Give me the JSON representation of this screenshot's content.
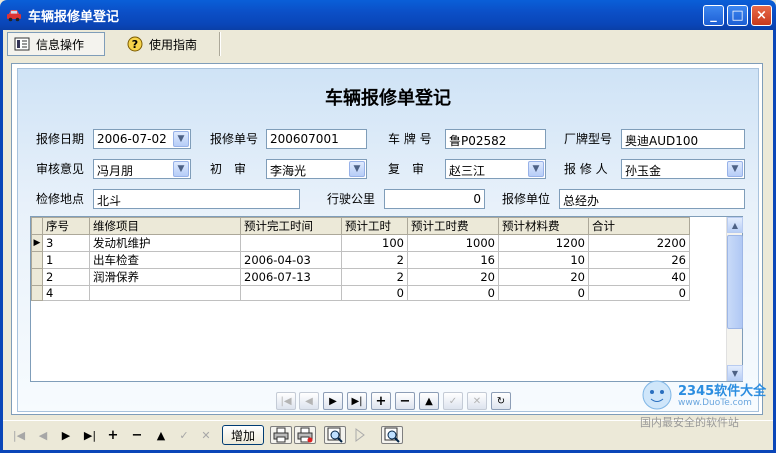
{
  "window": {
    "title": "车辆报修单登记",
    "controls": {
      "minimize": "_",
      "maximize": "□",
      "close": "×"
    }
  },
  "toolbar": {
    "items": [
      {
        "label": "信息操作",
        "icon": "form-list-icon",
        "active": true
      },
      {
        "label": "使用指南",
        "icon": "help-icon",
        "active": false
      }
    ]
  },
  "form": {
    "title": "车辆报修单登记",
    "fields": {
      "repair_date": {
        "label": "报修日期",
        "value": "2006-07-02"
      },
      "repair_no": {
        "label": "报修单号",
        "value": "200607001"
      },
      "plate_no": {
        "label": "车 牌 号",
        "value": "鲁P02582"
      },
      "model": {
        "label": "厂牌型号",
        "value": "奥迪AUD100"
      },
      "audit_opinion": {
        "label": "审核意见",
        "value": "冯月朋"
      },
      "first_review": {
        "label": "初　审",
        "value": "李海光"
      },
      "second_review": {
        "label": "复　审",
        "value": "赵三江"
      },
      "reporter": {
        "label": "报 修 人",
        "value": "孙玉金"
      },
      "location": {
        "label": "检修地点",
        "value": "北斗"
      },
      "mileage": {
        "label": "行驶公里",
        "value": "0"
      },
      "unit": {
        "label": "报修单位",
        "value": "总经办"
      }
    }
  },
  "grid": {
    "columns": [
      "序号",
      "维修项目",
      "预计完工时间",
      "预计工时",
      "预计工时费",
      "预计材料费",
      "合计"
    ],
    "rows": [
      {
        "current": true,
        "cells": [
          "3",
          "发动机维护",
          "",
          "100",
          "1000",
          "1200",
          "2200"
        ]
      },
      {
        "current": false,
        "cells": [
          "1",
          "出车检查",
          "2006-04-03",
          "2",
          "16",
          "10",
          "26"
        ]
      },
      {
        "current": false,
        "cells": [
          "2",
          "润滑保养",
          "2006-07-13",
          "2",
          "20",
          "20",
          "40"
        ]
      },
      {
        "current": false,
        "cells": [
          "4",
          "",
          "",
          "0",
          "0",
          "0",
          "0"
        ]
      }
    ]
  },
  "navigator": {
    "buttons": [
      {
        "name": "first",
        "glyph": "|◀",
        "enabled": false
      },
      {
        "name": "prior",
        "glyph": "◀",
        "enabled": false
      },
      {
        "name": "next",
        "glyph": "▶",
        "enabled": true
      },
      {
        "name": "last",
        "glyph": "▶|",
        "enabled": true
      },
      {
        "name": "insert",
        "glyph": "+",
        "enabled": true
      },
      {
        "name": "delete",
        "glyph": "−",
        "enabled": true
      },
      {
        "name": "edit",
        "glyph": "▲",
        "enabled": true
      },
      {
        "name": "post",
        "glyph": "✓",
        "enabled": false
      },
      {
        "name": "cancel",
        "glyph": "✕",
        "enabled": false
      },
      {
        "name": "refresh",
        "glyph": "↻",
        "enabled": true
      }
    ]
  },
  "bottombar": {
    "add_label": "增加",
    "nav": [
      {
        "name": "first",
        "glyph": "|◀",
        "enabled": false
      },
      {
        "name": "prior",
        "glyph": "◀",
        "enabled": false
      },
      {
        "name": "next",
        "glyph": "▶",
        "enabled": true
      },
      {
        "name": "last",
        "glyph": "▶|",
        "enabled": true
      },
      {
        "name": "insert",
        "glyph": "+",
        "enabled": true
      },
      {
        "name": "delete",
        "glyph": "−",
        "enabled": true
      },
      {
        "name": "edit",
        "glyph": "▲",
        "enabled": true
      },
      {
        "name": "post",
        "glyph": "✓",
        "enabled": false
      },
      {
        "name": "cancel",
        "glyph": "✕",
        "enabled": false
      }
    ]
  },
  "watermark": {
    "brand": "2345软件大全",
    "url": "www.DuoTe.com",
    "slogan": "国内最安全的软件站"
  }
}
